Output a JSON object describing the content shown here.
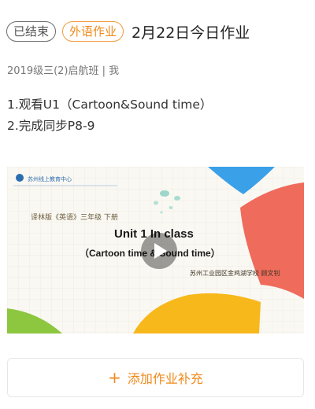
{
  "header": {
    "status_badge": "已结束",
    "type_badge": "外语作业",
    "title": "2月22日今日作业"
  },
  "meta": "2019级三(2)启航班 | 我",
  "content": {
    "lines": [
      "1.观看U1（Cartoon&Sound time）",
      "2.完成同步P8-9"
    ]
  },
  "video": {
    "org_text": "苏州线上教育中心",
    "book_text": "译林版《英语》三年级 下册",
    "unit_text": "Unit 1  In class",
    "subtitle_text": "（Cartoon time & Sound time）",
    "school_text": "苏州工业园区金鸡湖学校  顾文钊"
  },
  "add_button": {
    "label": "添加作业补充"
  },
  "colors": {
    "accent": "#f08a1c",
    "muted": "#777777"
  }
}
